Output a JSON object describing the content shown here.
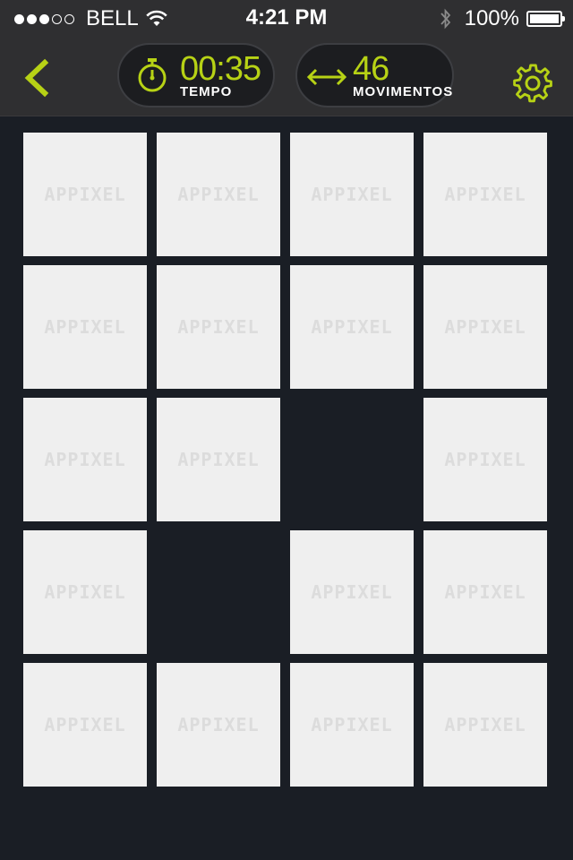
{
  "status_bar": {
    "carrier": "BELL",
    "time": "4:21 PM",
    "battery_percent": "100%",
    "signal_bars_filled": 3,
    "signal_bars_total": 5
  },
  "toolbar": {
    "back_icon": "chevron-left-icon",
    "settings_icon": "gear-icon",
    "timer": {
      "icon": "stopwatch-icon",
      "value": "00:35",
      "label": "TEMPO"
    },
    "moves": {
      "icon": "horizontal-arrows-icon",
      "value": "46",
      "label": "MOVIMENTOS"
    }
  },
  "colors": {
    "accent": "#b7d215",
    "background": "#1a1e25",
    "toolbar": "#2f2f31",
    "tile": "#efefef",
    "tile_logo": "#dcdcdc"
  },
  "board": {
    "tile_logo": "APPIXEL",
    "rows": [
      [
        "tile",
        "tile",
        "tile",
        "tile"
      ],
      [
        "tile",
        "tile",
        "tile",
        "tile"
      ],
      [
        "tile",
        "tile",
        "empty",
        "tile"
      ],
      [
        "tile",
        "empty",
        "tile",
        "tile"
      ],
      [
        "tile",
        "tile",
        "tile",
        "tile"
      ]
    ]
  }
}
